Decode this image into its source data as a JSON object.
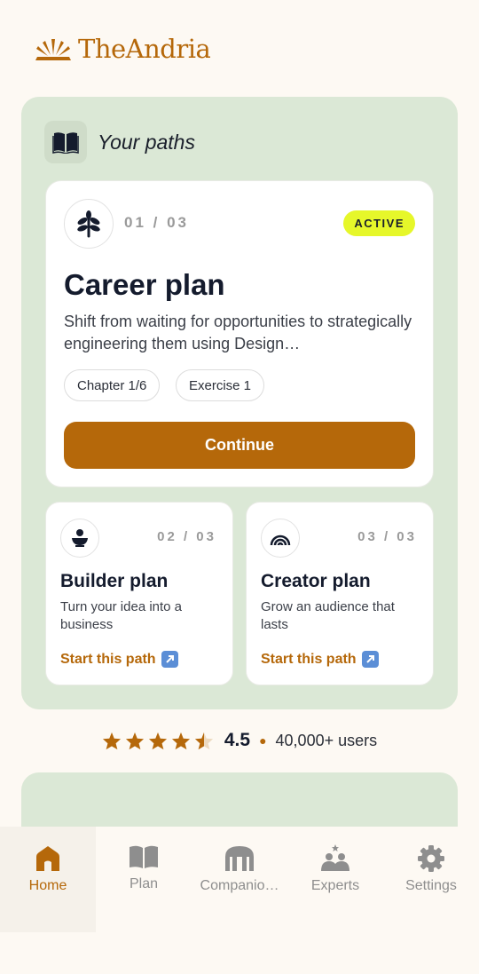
{
  "brand": {
    "name": "TheAndria"
  },
  "paths": {
    "header_title": "Your paths",
    "main": {
      "counter": "01 / 03",
      "status": "ACTIVE",
      "title": "Career plan",
      "description": "Shift from waiting for opportunities to strategically engineering them using Design…",
      "chips": [
        "Chapter 1/6",
        "Exercise 1"
      ],
      "button_label": "Continue"
    },
    "others": [
      {
        "counter": "02 / 03",
        "title": "Builder plan",
        "description": "Turn your idea into a business",
        "link_label": "Start this path",
        "icon": "builder-icon"
      },
      {
        "counter": "03 / 03",
        "title": "Creator plan",
        "description": "Grow an audience that lasts",
        "link_label": "Start this path",
        "icon": "rainbow-icon"
      }
    ]
  },
  "rating": {
    "value": "4.5",
    "stars": 4.5,
    "users": "40,000+ users"
  },
  "nav": [
    {
      "label": "Home",
      "icon": "home-icon",
      "active": true
    },
    {
      "label": "Plan",
      "icon": "book-icon",
      "active": false
    },
    {
      "label": "Companio…",
      "icon": "companion-icon",
      "active": false
    },
    {
      "label": "Experts",
      "icon": "experts-icon",
      "active": false
    },
    {
      "label": "Settings",
      "icon": "gear-icon",
      "active": false
    }
  ],
  "colors": {
    "accent": "#b5680a",
    "panel": "#dbe8d6",
    "badge": "#e6f72a",
    "background": "#fdf9f3"
  }
}
